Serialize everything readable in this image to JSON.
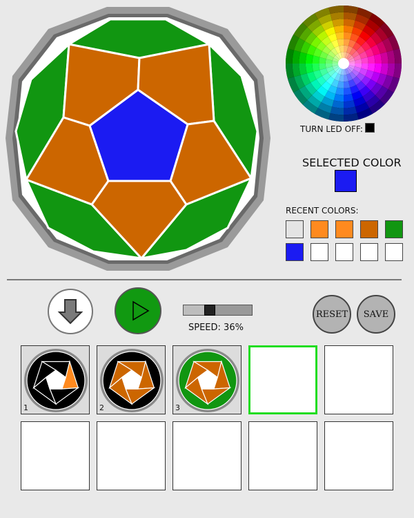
{
  "colors": {
    "green": "#119611",
    "orange": "#cc6600",
    "light_orange": "#ff8a1f",
    "blue": "#1b1bf2",
    "black": "#000000",
    "white": "#ffffff",
    "rim_outer": "#9a9a9a",
    "rim_inner": "#6a6a6a",
    "play_green": "#119911"
  },
  "led": {
    "label": "TURN LED OFF:"
  },
  "selected": {
    "label": "SELECTED COLOR",
    "color": "#1b1bf2"
  },
  "recent": {
    "label": "RECENT COLORS:",
    "colors": [
      "#e4e4e4",
      "#ff8a1f",
      "#ff8a1f",
      "#cc6600",
      "#119611",
      "#1b1bf2",
      "#ffffff",
      "#ffffff",
      "#ffffff",
      "#ffffff"
    ]
  },
  "controls": {
    "download_icon": "down-arrow-icon",
    "play_icon": "play-triangle-icon",
    "speed_label": "SPEED: 36%",
    "speed_value": 0.36,
    "reset_label": "RESET",
    "save_label": "SAVE"
  },
  "frames": [
    {
      "number": "1",
      "state": "filled",
      "colors": {
        "top": "#000000",
        "upper_left": "#000000",
        "upper_right": "#000000",
        "right": "#ff8a1f",
        "bottom": "#000000",
        "left": "#000000",
        "outer": "#000000",
        "center": "#ffffff"
      }
    },
    {
      "number": "2",
      "state": "filled",
      "colors": {
        "top": "#cc6600",
        "upper_left": "#cc6600",
        "upper_right": "#cc6600",
        "right": "#cc6600",
        "bottom": "#cc6600",
        "left": "#cc6600",
        "outer": "#000000",
        "center": "#ffffff"
      }
    },
    {
      "number": "3",
      "state": "filled",
      "colors": {
        "top": "#cc6600",
        "upper_left": "#cc6600",
        "upper_right": "#cc6600",
        "right": "#cc6600",
        "bottom": "#cc6600",
        "left": "#cc6600",
        "outer": "#119611",
        "center": "#ffffff"
      }
    },
    {
      "number": "",
      "state": "active"
    },
    {
      "number": "",
      "state": "empty"
    },
    {
      "number": "",
      "state": "empty"
    },
    {
      "number": "",
      "state": "empty"
    },
    {
      "number": "",
      "state": "empty"
    },
    {
      "number": "",
      "state": "empty"
    },
    {
      "number": "",
      "state": "empty"
    }
  ]
}
